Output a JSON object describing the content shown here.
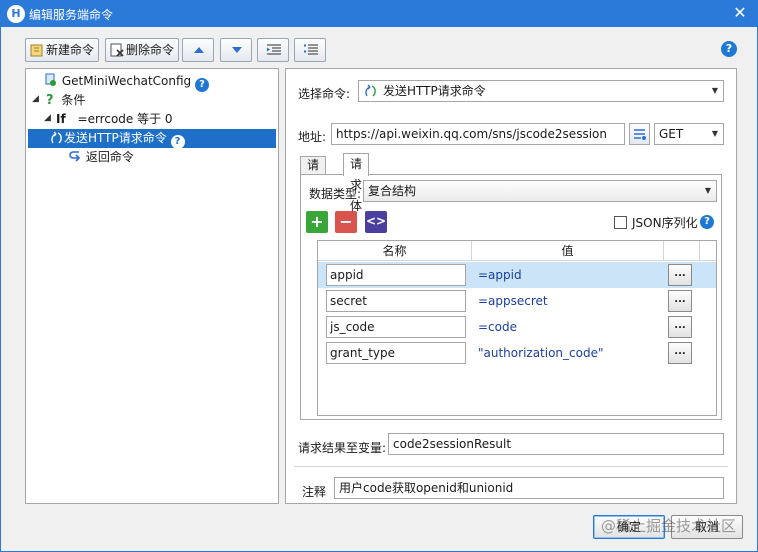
{
  "window": {
    "app_icon": "H",
    "title": "编辑服务端命令",
    "close_glyph": "✕"
  },
  "toolbar": {
    "new_label": "新建命令",
    "delete_label": "删除命令",
    "help_glyph": "?"
  },
  "tree": {
    "root_label": "GetMiniWechatConfig",
    "condition_label": "条件",
    "if_keyword": "If",
    "if_condition": "=errcode 等于 0",
    "http_label": "发送HTTP请求命令",
    "return_label": "返回命令",
    "help_glyph": "?",
    "condition_glyph": "?"
  },
  "form": {
    "select_command_label": "选择命令:",
    "select_command_value": "发送HTTP请求命令",
    "address_label": "地址:",
    "address_value": "https://api.weixin.qq.com/sns/jscode2session",
    "method_value": "GET",
    "tab_headers": "请求头",
    "tab_body": "请求体",
    "data_type_label": "数据类型:",
    "data_type_value": "复合结构",
    "json_serialize_label": "JSON序列化",
    "json_serialize_checked": false,
    "help_glyph": "?",
    "result_var_label": "请求结果至变量:",
    "result_var_value": "code2sessionResult",
    "note_label": "注释",
    "note_value": "用户code获取openid和unionid"
  },
  "grid": {
    "col_name": "名称",
    "col_value": "值",
    "dots": "...",
    "rows": [
      {
        "name": "appid",
        "value": "=appid",
        "selected": true
      },
      {
        "name": "secret",
        "value": "=appsecret",
        "selected": false
      },
      {
        "name": "js_code",
        "value": "=code",
        "selected": false
      },
      {
        "name": "grant_type",
        "value": "\"authorization_code\"",
        "selected": false
      }
    ]
  },
  "footer": {
    "ok_label": "确定",
    "cancel_label": "取消"
  },
  "watermark": "@稀土掘金技术社区",
  "colors": {
    "title_bar": "#2b79d8",
    "selection": "#1e6fc8",
    "add_button": "#3aa63a",
    "remove_button": "#d9534f",
    "code_button": "#4a3f9e"
  }
}
